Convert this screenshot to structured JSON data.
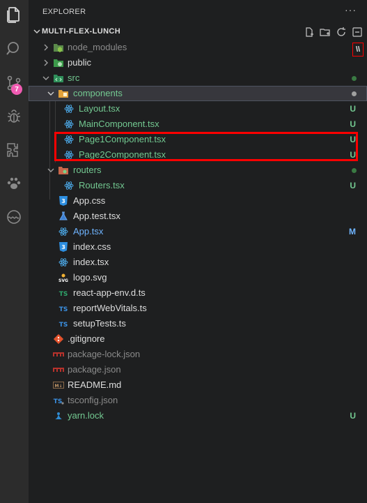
{
  "explorer": {
    "title": "EXPLORER",
    "more": "···",
    "root_name": "MULTI-FLEX-LUNCH"
  },
  "activity_bar": {
    "scm_badge": "7",
    "items": [
      "files-icon",
      "search-icon",
      "source-control-icon",
      "debug-icon",
      "extensions-icon",
      "paw-icon",
      "remote-icon"
    ]
  },
  "tree": {
    "node_modules": "node_modules",
    "public": "public",
    "src": "src",
    "components": "components",
    "layout": "Layout.tsx",
    "main": "MainComponent.tsx",
    "page1": "Page1Component.tsx",
    "page2": "Page2Component.tsx",
    "routers": "routers",
    "routers_file": "Routers.tsx",
    "app_css": "App.css",
    "app_test": "App.test.tsx",
    "app_tsx": "App.tsx",
    "index_css": "index.css",
    "index_tsx": "index.tsx",
    "logo": "logo.svg",
    "react_env": "react-app-env.d.ts",
    "web_vitals": "reportWebVitals.ts",
    "setup_tests": "setupTests.ts",
    "gitignore": ".gitignore",
    "pkg_lock": "package-lock.json",
    "pkg": "package.json",
    "readme": "README.md",
    "tsconfig": "tsconfig.json",
    "yarn": "yarn.lock"
  },
  "status": {
    "untracked": "U",
    "modified": "M"
  },
  "overlay": {
    "corner_mark": "\\\\"
  },
  "colors": {
    "untracked": "#73c991",
    "modified": "#6fb4ff",
    "highlight": "#ff0000"
  }
}
